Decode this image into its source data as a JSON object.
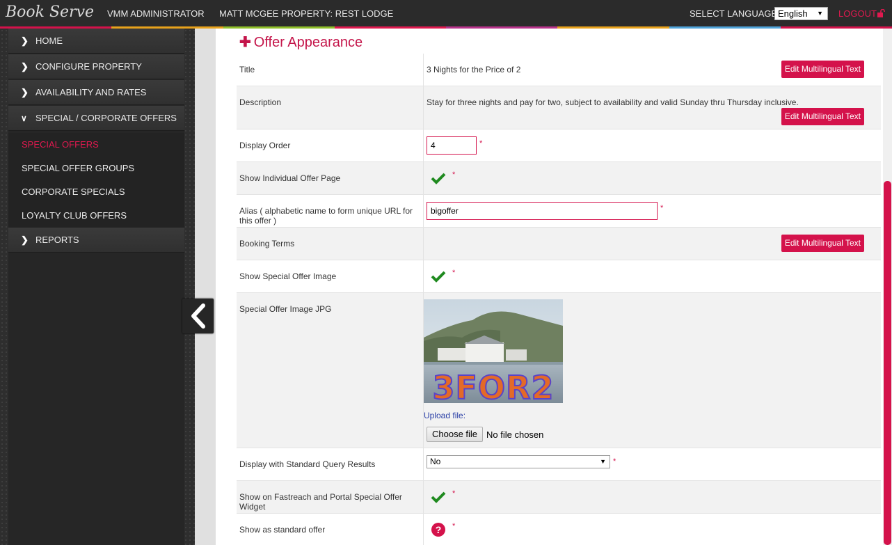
{
  "header": {
    "logo": "Book Serve",
    "role": "VMM ADMINISTRATOR",
    "user": "MATT MCGEE",
    "property": "PROPERTY: REST LODGE",
    "language_label": "SELECT LANGUAGE",
    "language_value": "English",
    "logout": "LOGOUT"
  },
  "colors": {
    "accent": "#d4124b",
    "stripe": [
      "#d4124b",
      "#e8a21c",
      "#8fbf2a",
      "#e0194f",
      "#b8338c",
      "#e8a21c",
      "#4fa3d9",
      "#d4124b"
    ]
  },
  "sidebar": {
    "items": [
      {
        "label": "HOME",
        "icon": "chevron-right-icon"
      },
      {
        "label": "CONFIGURE PROPERTY",
        "icon": "chevron-right-icon"
      },
      {
        "label": "AVAILABILITY AND RATES",
        "icon": "chevron-right-icon"
      },
      {
        "label": "SPECIAL / CORPORATE OFFERS",
        "icon": "chevron-down-icon"
      }
    ],
    "sub_items": [
      {
        "label": "SPECIAL OFFERS",
        "active": true
      },
      {
        "label": "SPECIAL OFFER GROUPS"
      },
      {
        "label": "CORPORATE SPECIALS"
      },
      {
        "label": "LOYALTY CLUB OFFERS"
      }
    ],
    "reports": {
      "label": "REPORTS",
      "icon": "chevron-right-icon"
    }
  },
  "section": {
    "title": "Offer Appearance"
  },
  "form": {
    "title_label": "Title",
    "title_value": "3 Nights for the Price of 2",
    "description_label": "Description",
    "description_value": "Stay for three nights and pay for two, subject to availability and valid Sunday thru Thursday inclusive.",
    "edit_multilingual": "Edit Multilingual Text",
    "display_order_label": "Display Order",
    "display_order_value": "4",
    "show_individual_label": "Show Individual Offer Page",
    "alias_label": "Alias ( alphabetic name to form unique URL for this offer )",
    "alias_value": "bigoffer",
    "booking_terms_label": "Booking Terms",
    "show_image_label": "Show Special Offer Image",
    "image_label": "Special Offer Image JPG",
    "image_text": "3FOR2",
    "upload_label": "Upload file:",
    "choose_file": "Choose file",
    "no_file": "No file chosen",
    "standard_query_label": "Display with Standard Query Results",
    "standard_query_value": "No",
    "fastreach_label": "Show on Fastreach and Portal Special Offer Widget",
    "standard_offer_label": "Show as standard offer",
    "required_mark": "*",
    "help_mark": "?"
  }
}
